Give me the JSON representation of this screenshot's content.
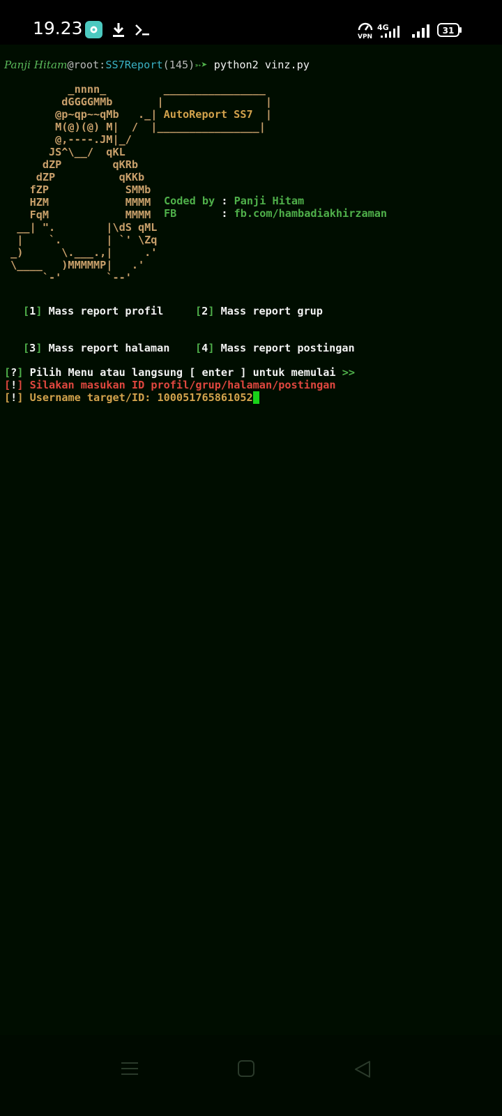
{
  "status_bar": {
    "time": "19.23",
    "network": "4G",
    "vpn": "VPN",
    "battery": "31",
    "icons": [
      "app-notification-icon",
      "download-icon",
      "terminal-icon",
      "vpn-icon",
      "signal-4g-icon",
      "signal-bars-icon",
      "battery-icon"
    ]
  },
  "terminal": {
    "prompt": {
      "user": "Panji Hitam",
      "at_host": "@root:",
      "dir": "SS7Report",
      "count": "(145)",
      "arrow": "➳➤",
      "command": " python2 vinz.py"
    },
    "banner": {
      "title": "AutoReport SS7",
      "art": [
        "          _nnnn_         ________________",
        "         dGGGGMMb       |                |",
        "        @p~qp~~qMb   ._| AutoReport SS7  |",
        "        M(@)(@) M|  /  |________________|",
        "        @,----.JM|_/",
        "       JS^\\__/  qKL",
        "      dZP        qKRb",
        "     dZP          qKKb",
        "    fZP            SMMb",
        "    HZM            MMMM",
        "    FqM            MMMM",
        "  __| \".        |\\dS qML",
        "  |    `.       | `' \\Zq",
        " _)      \\.___.,|     .'",
        " \\____   )MMMMMP|   .'",
        "      `-'       `--'"
      ]
    },
    "credits": {
      "coded_label": "Coded by",
      "coded_value": "Panji Hitam",
      "fb_label": "FB",
      "fb_value": "fb.com/hambadiakhirzaman",
      "sep": ":"
    },
    "menu": [
      {
        "num": "1",
        "label": "Mass report profil"
      },
      {
        "num": "2",
        "label": "Mass report grup"
      },
      {
        "num": "3",
        "label": "Mass report halaman"
      },
      {
        "num": "4",
        "label": "Mass report postingan"
      }
    ],
    "messages": {
      "q_mark": "?",
      "info_mark": "!",
      "choose": "Pilih Menu atau langsung [ enter ] untuk memulai",
      "choose_arrow": ">>",
      "enter_id": "Silakan masukan ID profil/grup/halaman/postingan",
      "username_label": "Username target/ID: ",
      "username_value": "100051765861052"
    }
  },
  "nav_bar": {
    "buttons": [
      "menu-icon",
      "home-icon",
      "back-icon"
    ]
  },
  "colors": {
    "terminal_bg": "#000d00",
    "green": "#4fb04a",
    "gold": "#d2a24c",
    "red": "#e0473f",
    "teal": "#3ab0c4",
    "cursor": "#19d319"
  }
}
